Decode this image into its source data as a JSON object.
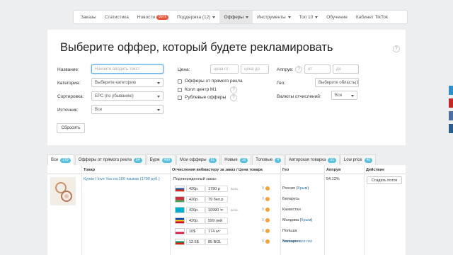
{
  "nav": {
    "items": [
      {
        "label": "Заказы"
      },
      {
        "label": "Статистика"
      },
      {
        "label": "Новости",
        "badge": "8979"
      },
      {
        "label": "Поддержка (12)",
        "caret": true
      },
      {
        "label": "Офферы",
        "caret": true,
        "active": true
      },
      {
        "label": "Инструменты",
        "caret": true
      },
      {
        "label": "Топ 10",
        "caret": true
      },
      {
        "label": "Обучение"
      },
      {
        "label": "Кабинет TikTok"
      }
    ]
  },
  "filters": {
    "heading": "Выберите оффер, который будете рекламировать",
    "name_label": "Название:",
    "name_placeholder": "Начните вводить текст",
    "category_label": "Категория:",
    "category_value": "Выберите категорию",
    "sort_label": "Сортировка:",
    "sort_value": "EPC (по убыванию)",
    "source_label": "Источник:",
    "source_value": "Все",
    "price_label": "Цена:",
    "price_from": "цена от",
    "price_to": "цена до",
    "cb_direct": "Офферы от прямого рекла",
    "cb_callcenter": "Колл центр М1",
    "cb_rub": "Рублевые офферы",
    "approve_label": "Аппрув:",
    "approve_from": "от",
    "approve_to": "до",
    "geo_label": "Гео:",
    "geo_value": "Выберите область(1)",
    "currency_label": "Валюты отчислений:",
    "currency_value": "Все",
    "reset_button": "Сбросить",
    "help": "?"
  },
  "tabs": [
    {
      "label": "Все",
      "count": "279",
      "active": true
    },
    {
      "label": "Офферы от прямого рекла",
      "count": "54"
    },
    {
      "label": "Бурж",
      "count": "499"
    },
    {
      "label": "Мои офферы",
      "count": "51"
    },
    {
      "label": "Новые",
      "count": "16"
    },
    {
      "label": "Топовые",
      "count": "4"
    },
    {
      "label": "Авторская товарка",
      "count": "31"
    },
    {
      "label": "Low price",
      "count": "40"
    }
  ],
  "table": {
    "headers": {
      "product": "Товар",
      "payout": "Отчисления вебмастеру за заказ / Цена товара",
      "geo": "Гео",
      "approve": "Аппрув",
      "action": "Действие"
    },
    "row": {
      "title": "Кулон I love You на 100 языках (1790 руб.)",
      "confirmed": "Подтвержденный заказ:",
      "approve": "54.12%",
      "button": "Создать поток",
      "lines": [
        {
          "payout": "420р.",
          "price": "1790 р",
          "geo": "Россия",
          "geo_link": "Крым",
          "flag": [
            "#fff",
            "#1c57a5",
            "#d52b1e"
          ]
        },
        {
          "payout": "420р.",
          "price": "79 бел.р",
          "geo": "Беларусь",
          "flag": [
            "#c8313e",
            "#c8313e",
            "#4aa657"
          ]
        },
        {
          "payout": "420р.",
          "price": "10990 тг",
          "geo": "Казахстан",
          "flag": [
            "#00afca",
            "#00afca",
            "#00afca"
          ]
        },
        {
          "payout": "420р.",
          "price": "599 лей",
          "geo": "Молдова",
          "geo_link": "Крым",
          "flag": [
            "#0046ae",
            "#ffd200",
            "#cc092f"
          ]
        },
        {
          "payout": "10$",
          "price": "174 зл",
          "geo": "Польша",
          "flag": [
            "#fff",
            "#fff",
            "#dc143c"
          ]
        },
        {
          "payout": "12.5$",
          "price": "85 BGL",
          "geo": "Болгария",
          "flag": [
            "#fff",
            "#00966e",
            "#d62612"
          ]
        }
      ],
      "show_all_geo": "показать все гео",
      "hint": "0",
      "icon_label": "BGSL"
    }
  },
  "colors": {
    "accent": "#2a7ab0",
    "badge": "#5bc0de",
    "news_badge": "#e9553b"
  }
}
